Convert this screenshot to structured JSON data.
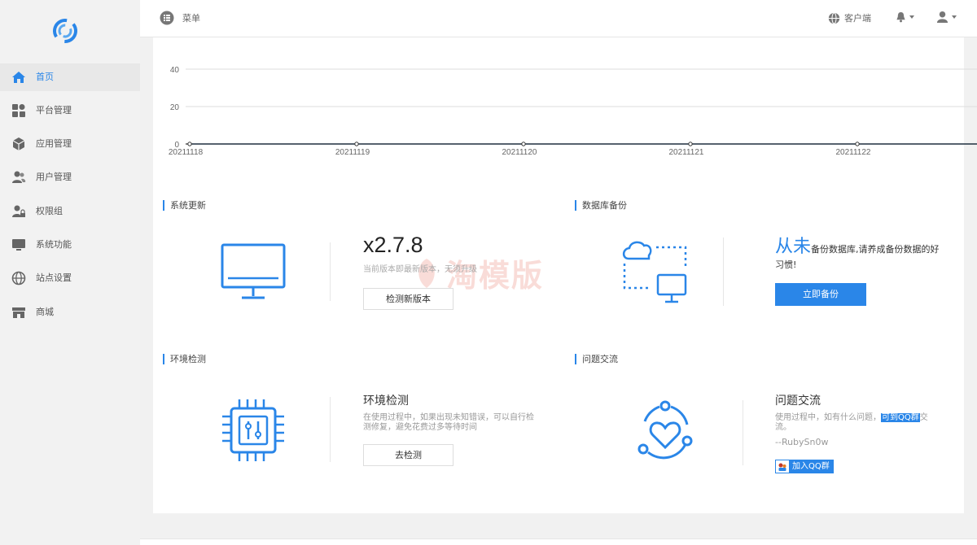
{
  "sidebar": {
    "items": [
      {
        "label": "首页",
        "icon": "home-icon",
        "active": true
      },
      {
        "label": "平台管理",
        "icon": "grid-icon"
      },
      {
        "label": "应用管理",
        "icon": "cube-icon"
      },
      {
        "label": "用户管理",
        "icon": "users-icon"
      },
      {
        "label": "权限组",
        "icon": "user-lock-icon"
      },
      {
        "label": "系统功能",
        "icon": "monitor-icon"
      },
      {
        "label": "站点设置",
        "icon": "globe-icon"
      },
      {
        "label": "商城",
        "icon": "store-icon"
      }
    ]
  },
  "header": {
    "menu_label": "菜单",
    "client_label": "客户端"
  },
  "chart_data": {
    "type": "line",
    "categories": [
      "20211118",
      "20211119",
      "20211120",
      "20211121",
      "20211122"
    ],
    "series": [
      {
        "values": [
          0,
          0,
          0,
          0,
          0
        ]
      }
    ],
    "yticks": [
      0,
      20,
      40
    ],
    "ylim": [
      0,
      40
    ],
    "grid": true
  },
  "update": {
    "title": "系统更新",
    "version": "x2.7.8",
    "status": "当前版本即最新版本，无须升级",
    "button": "检测新版本"
  },
  "backup": {
    "title": "数据库备份",
    "lead": "从未",
    "text": "备份数据库,请养成备份数据的好习惯!",
    "button": "立即备份"
  },
  "env": {
    "section_title": "环境检测",
    "card_title": "环境检测",
    "desc": "在使用过程中，如果出现未知错误，可以自行检测修复，避免花费过多等待时间",
    "button": "去检测"
  },
  "qa": {
    "section_title": "问题交流",
    "card_title": "问题交流",
    "desc_pre": "使用过程中，如有什么问题，",
    "desc_highlight": "可到QQ群",
    "desc_post": "交流。",
    "signature": "--RubySn0w",
    "button": "加入QQ群"
  },
  "watermark": "淘模版",
  "colors": {
    "accent": "#2a86e8",
    "watermark": "#e0452c"
  }
}
